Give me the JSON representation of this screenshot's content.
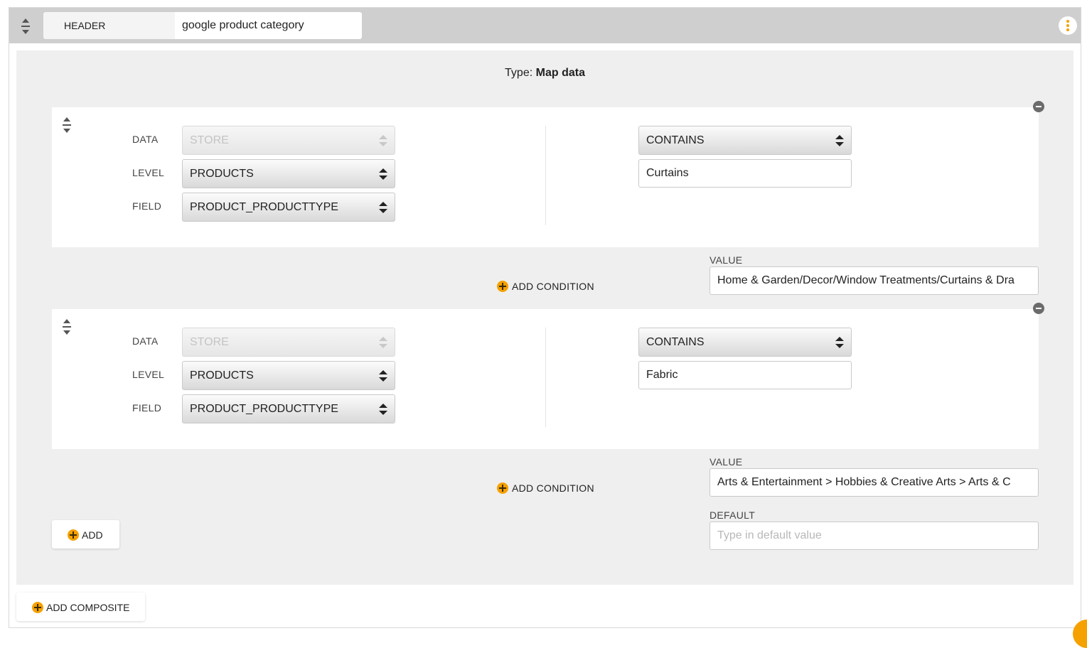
{
  "header": {
    "label": "HEADER",
    "name_value": "google product category"
  },
  "type_line": {
    "prefix": "Type:",
    "value": "Map data"
  },
  "conditions": [
    {
      "data_label": "DATA",
      "data_value": "STORE",
      "level_label": "LEVEL",
      "level_value": "PRODUCTS",
      "field_label": "FIELD",
      "field_value": "PRODUCT_PRODUCTTYPE",
      "operator": "CONTAINS",
      "match_value": "Curtains",
      "value_label": "VALUE",
      "value": "Home & Garden/Decor/Window Treatments/Curtains & Dra",
      "add_condition_label": "ADD CONDITION"
    },
    {
      "data_label": "DATA",
      "data_value": "STORE",
      "level_label": "LEVEL",
      "level_value": "PRODUCTS",
      "field_label": "FIELD",
      "field_value": "PRODUCT_PRODUCTTYPE",
      "operator": "CONTAINS",
      "match_value": "Fabric",
      "value_label": "VALUE",
      "value": "Arts & Entertainment > Hobbies & Creative Arts > Arts & C",
      "add_condition_label": "ADD CONDITION"
    }
  ],
  "add_label": "ADD",
  "default": {
    "label": "DEFAULT",
    "placeholder": "Type in default value"
  },
  "add_composite_label": "ADD COMPOSITE",
  "colors": {
    "accent": "#f5a100",
    "topbar": "#cfcfcf",
    "panel": "#efefef"
  }
}
